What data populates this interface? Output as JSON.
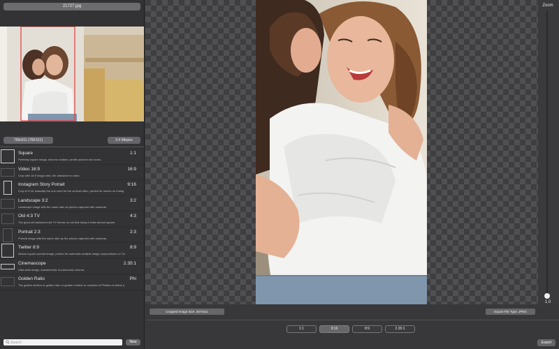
{
  "file": {
    "name": "21727.jpg"
  },
  "info": {
    "dimensions": "768x511 (768:511)",
    "size": "3.4 Mbytes"
  },
  "ratios": [
    {
      "name": "Square",
      "value": "1:1",
      "description": "Perfectly square image, ideal for avatars, profile pictures and icons."
    },
    {
      "name": "Video 16:9",
      "value": "16:9",
      "description": "Crop with 16:9 image ratio, the standard for video."
    },
    {
      "name": "Instagram Story Potrait",
      "value": "9:16",
      "description": "Crop in 9:16, basically the one used for the vertical video, perfect for stories on Instag"
    },
    {
      "name": "Landscape 3:2",
      "value": "3:2",
      "description": "Landscape image with the same ratio as photos captured with cameras."
    },
    {
      "name": "Old 4:3 TV",
      "value": "4:3",
      "description": "The good old fashioned old TV format, so old that today it looks almost square."
    },
    {
      "name": "Portrait 2:3",
      "value": "2:3",
      "description": "Portrait image with the same ratio as the photos captured with cameras."
    },
    {
      "name": "Twitter 8:9",
      "value": "8:9",
      "description": "Almost square portrait image, perfect for automatic multiple image compositions on Tw"
    },
    {
      "name": "Cinemascope",
      "value": "2.35:1",
      "description": "Ultra-wide image, characteristic of panoramic cinema."
    },
    {
      "name": "Golden Ratio",
      "value": "Phi",
      "description": "The golden section or golden ratio or golden number or constant of Phidias or divine p"
    }
  ],
  "search": {
    "placeholder": "Search"
  },
  "new_label": "New",
  "zoom": {
    "label": "Zoom",
    "value": "1.0"
  },
  "cropped_size": "Cropped Image Size: 287x511",
  "export_type": "Export File Type: JPEG",
  "quick_ratios": [
    {
      "label": "1:1",
      "active": false
    },
    {
      "label": "9:16",
      "active": true
    },
    {
      "label": "8:9",
      "active": false
    },
    {
      "label": "2.35:1",
      "active": false
    }
  ],
  "export_label": "Export",
  "colors": {
    "background": "#3a3a3c",
    "crop_frame": "#e03a3a",
    "active_segment": "#67676a"
  }
}
